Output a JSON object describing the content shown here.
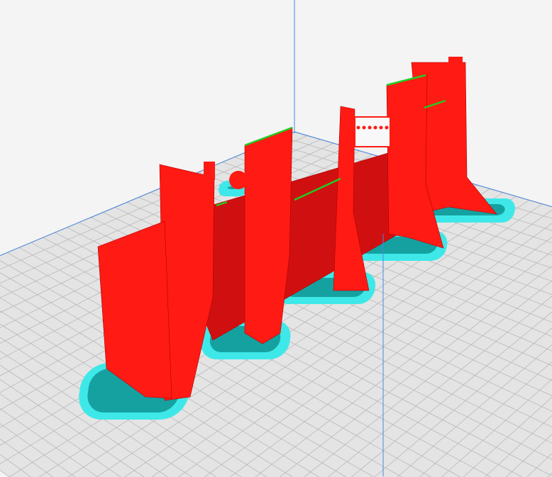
{
  "viewport": {
    "kind": "3d-slice-preview",
    "colors": {
      "background": "#f4f4f4",
      "plate": "#e4e4e4",
      "grid": "#b8b8b8",
      "plate_border": "#5a8fd8",
      "axis": "#4a86e8",
      "wall": "#ff1a14",
      "wall_dark": "#d01010",
      "skin_top": "#22cc22",
      "support": "#3fe8e8",
      "support_dark": "#0a8a8a"
    }
  }
}
